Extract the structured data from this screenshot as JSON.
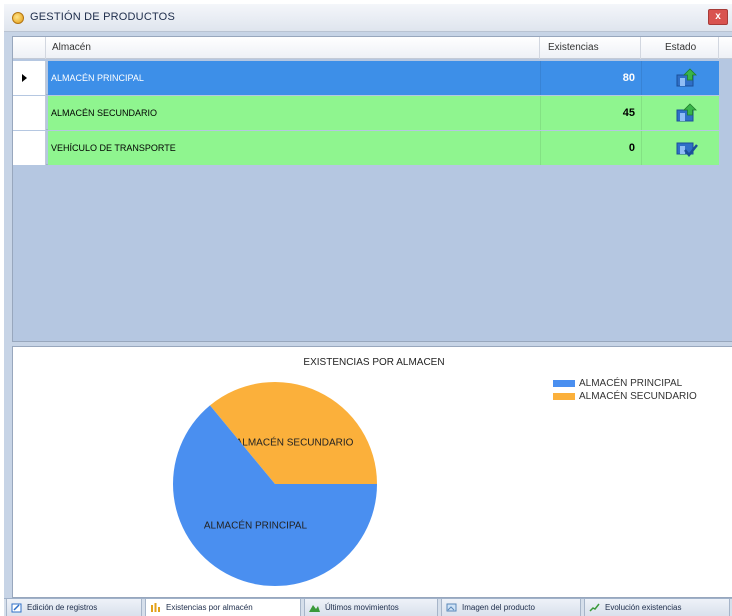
{
  "window": {
    "title": "GESTIÓN DE PRODUCTOS",
    "close_label": "x"
  },
  "grid": {
    "columns": [
      "Almacén",
      "Existencias",
      "Estado"
    ],
    "rows": [
      {
        "name": "ALMACÉN PRINCIPAL",
        "qty": "80",
        "state_icon": "warehouse-up-icon",
        "selected": true
      },
      {
        "name": "ALMACÉN SECUNDARIO",
        "qty": "45",
        "state_icon": "warehouse-up-icon",
        "selected": false
      },
      {
        "name": "VEHÍCULO DE TRANSPORTE",
        "qty": "0",
        "state_icon": "warehouse-check-icon",
        "selected": false
      }
    ]
  },
  "chart_data": {
    "type": "pie",
    "title": "EXISTENCIAS POR ALMACEN",
    "categories": [
      "ALMACÉN PRINCIPAL",
      "ALMACÉN SECUNDARIO"
    ],
    "values": [
      80,
      45
    ],
    "colors": [
      "#4a8ff0",
      "#fbb03b"
    ],
    "legend_position": "top-right"
  },
  "tabs": [
    {
      "label": "Edición de registros",
      "icon": "edit-icon",
      "active": false
    },
    {
      "label": "Existencias por almacén",
      "icon": "chart-icon",
      "active": true
    },
    {
      "label": "Últimos movimientos",
      "icon": "mountain-chart-icon",
      "active": false
    },
    {
      "label": "Imagen del producto",
      "icon": "image-icon",
      "active": false
    },
    {
      "label": "Evolución existencias",
      "icon": "trend-icon",
      "active": false
    }
  ]
}
